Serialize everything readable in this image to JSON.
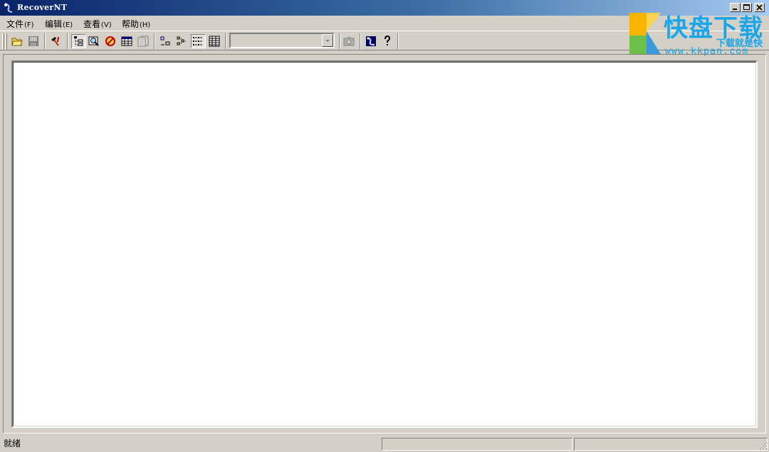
{
  "window": {
    "title": "RecoverNT"
  },
  "menu": [
    {
      "label": "文件",
      "accel": "(F)"
    },
    {
      "label": "编辑",
      "accel": "(E)"
    },
    {
      "label": "查看",
      "accel": "(V)"
    },
    {
      "label": "帮助",
      "accel": "(H)"
    }
  ],
  "toolbar": {
    "combo_value": ""
  },
  "status": {
    "text": "就绪",
    "pane2": "",
    "pane3": ""
  },
  "watermark": {
    "brand": "快盘下载",
    "slogan": "下载就是快",
    "url": "www.kkpan.com"
  },
  "colors": {
    "title_start": "#0a246a",
    "title_end": "#a6caf0",
    "face": "#d4d0c8",
    "watermark": "#1aa6e8"
  }
}
